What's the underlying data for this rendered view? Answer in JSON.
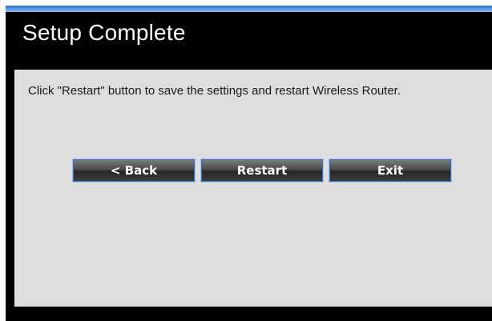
{
  "title": "Setup Complete",
  "message": "Click \"Restart\" button to save the settings and restart Wireless Router.",
  "buttons": {
    "back": "< Back",
    "restart": "Restart",
    "exit": "Exit"
  },
  "colors": {
    "frame": "#000000",
    "content_bg": "#dedede",
    "accent": "#5b97ea",
    "button_border": "#3f6fb5"
  }
}
